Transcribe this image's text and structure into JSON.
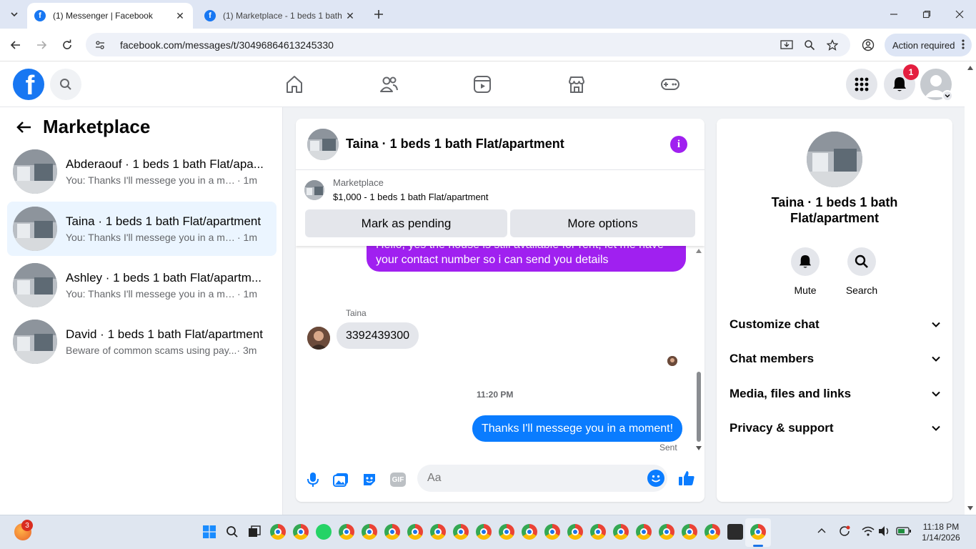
{
  "browser": {
    "tabs": [
      {
        "title": "(1) Messenger | Facebook",
        "active": true
      },
      {
        "title": "(1) Marketplace - 1 beds 1 bath",
        "active": false
      }
    ],
    "url": "facebook.com/messages/t/30496864613245330",
    "action_required_label": "Action required"
  },
  "fb_nav": {
    "notification_count": "1"
  },
  "left_panel": {
    "title": "Marketplace",
    "conversations": [
      {
        "name": "Abderaouf · 1 beds 1 bath Flat/apa...",
        "snippet": "You: Thanks I'll messege you in a mo...",
        "time": "· 1m",
        "selected": false
      },
      {
        "name": "Taina · 1 beds 1 bath Flat/apartment",
        "snippet": "You: Thanks I'll messege you in a mo...",
        "time": "· 1m",
        "selected": true
      },
      {
        "name": "Ashley · 1 beds 1 bath Flat/apartm...",
        "snippet": "You: Thanks I'll messege you in a mo...",
        "time": "· 1m",
        "selected": false
      },
      {
        "name": "David · 1 beds 1 bath Flat/apartment",
        "snippet": "Beware of common scams using pay...",
        "time": "· 3m",
        "selected": false
      }
    ]
  },
  "chat": {
    "title": "Taina · 1 beds 1 bath Flat/apartment",
    "listing": {
      "source": "Marketplace",
      "price_line": "$1,000 - 1 beds 1 bath Flat/apartment",
      "mark_pending_label": "Mark as pending",
      "more_options_label": "More options"
    },
    "messages": {
      "outgoing_partial_line1": "Hello, yes the house is still available for rent, let me have",
      "outgoing_partial_line2": "your contact number so i can send you details",
      "incoming_sender": "Taina",
      "incoming_text": "3392439300",
      "timestamp": "11:20 PM",
      "outgoing_last": "Thanks I'll messege you in a moment!",
      "status": "Sent"
    },
    "composer_placeholder": "Aa",
    "gif_label": "GIF"
  },
  "info_panel": {
    "name": "Taina · 1 beds 1 bath Flat/apartment",
    "actions": [
      {
        "label": "Mute",
        "icon": "bell-icon"
      },
      {
        "label": "Search",
        "icon": "search-icon"
      }
    ],
    "sections": [
      "Customize chat",
      "Chat members",
      "Media, files and links",
      "Privacy & support"
    ]
  },
  "taskbar": {
    "time": "11:18 PM",
    "date": "1/14/2026",
    "weather_badge": "3"
  },
  "colors": {
    "fb_blue": "#1877f2",
    "messenger_purple": "#a020f0",
    "messenger_blue": "#0a7cff",
    "selected_row": "#ebf5ff"
  }
}
